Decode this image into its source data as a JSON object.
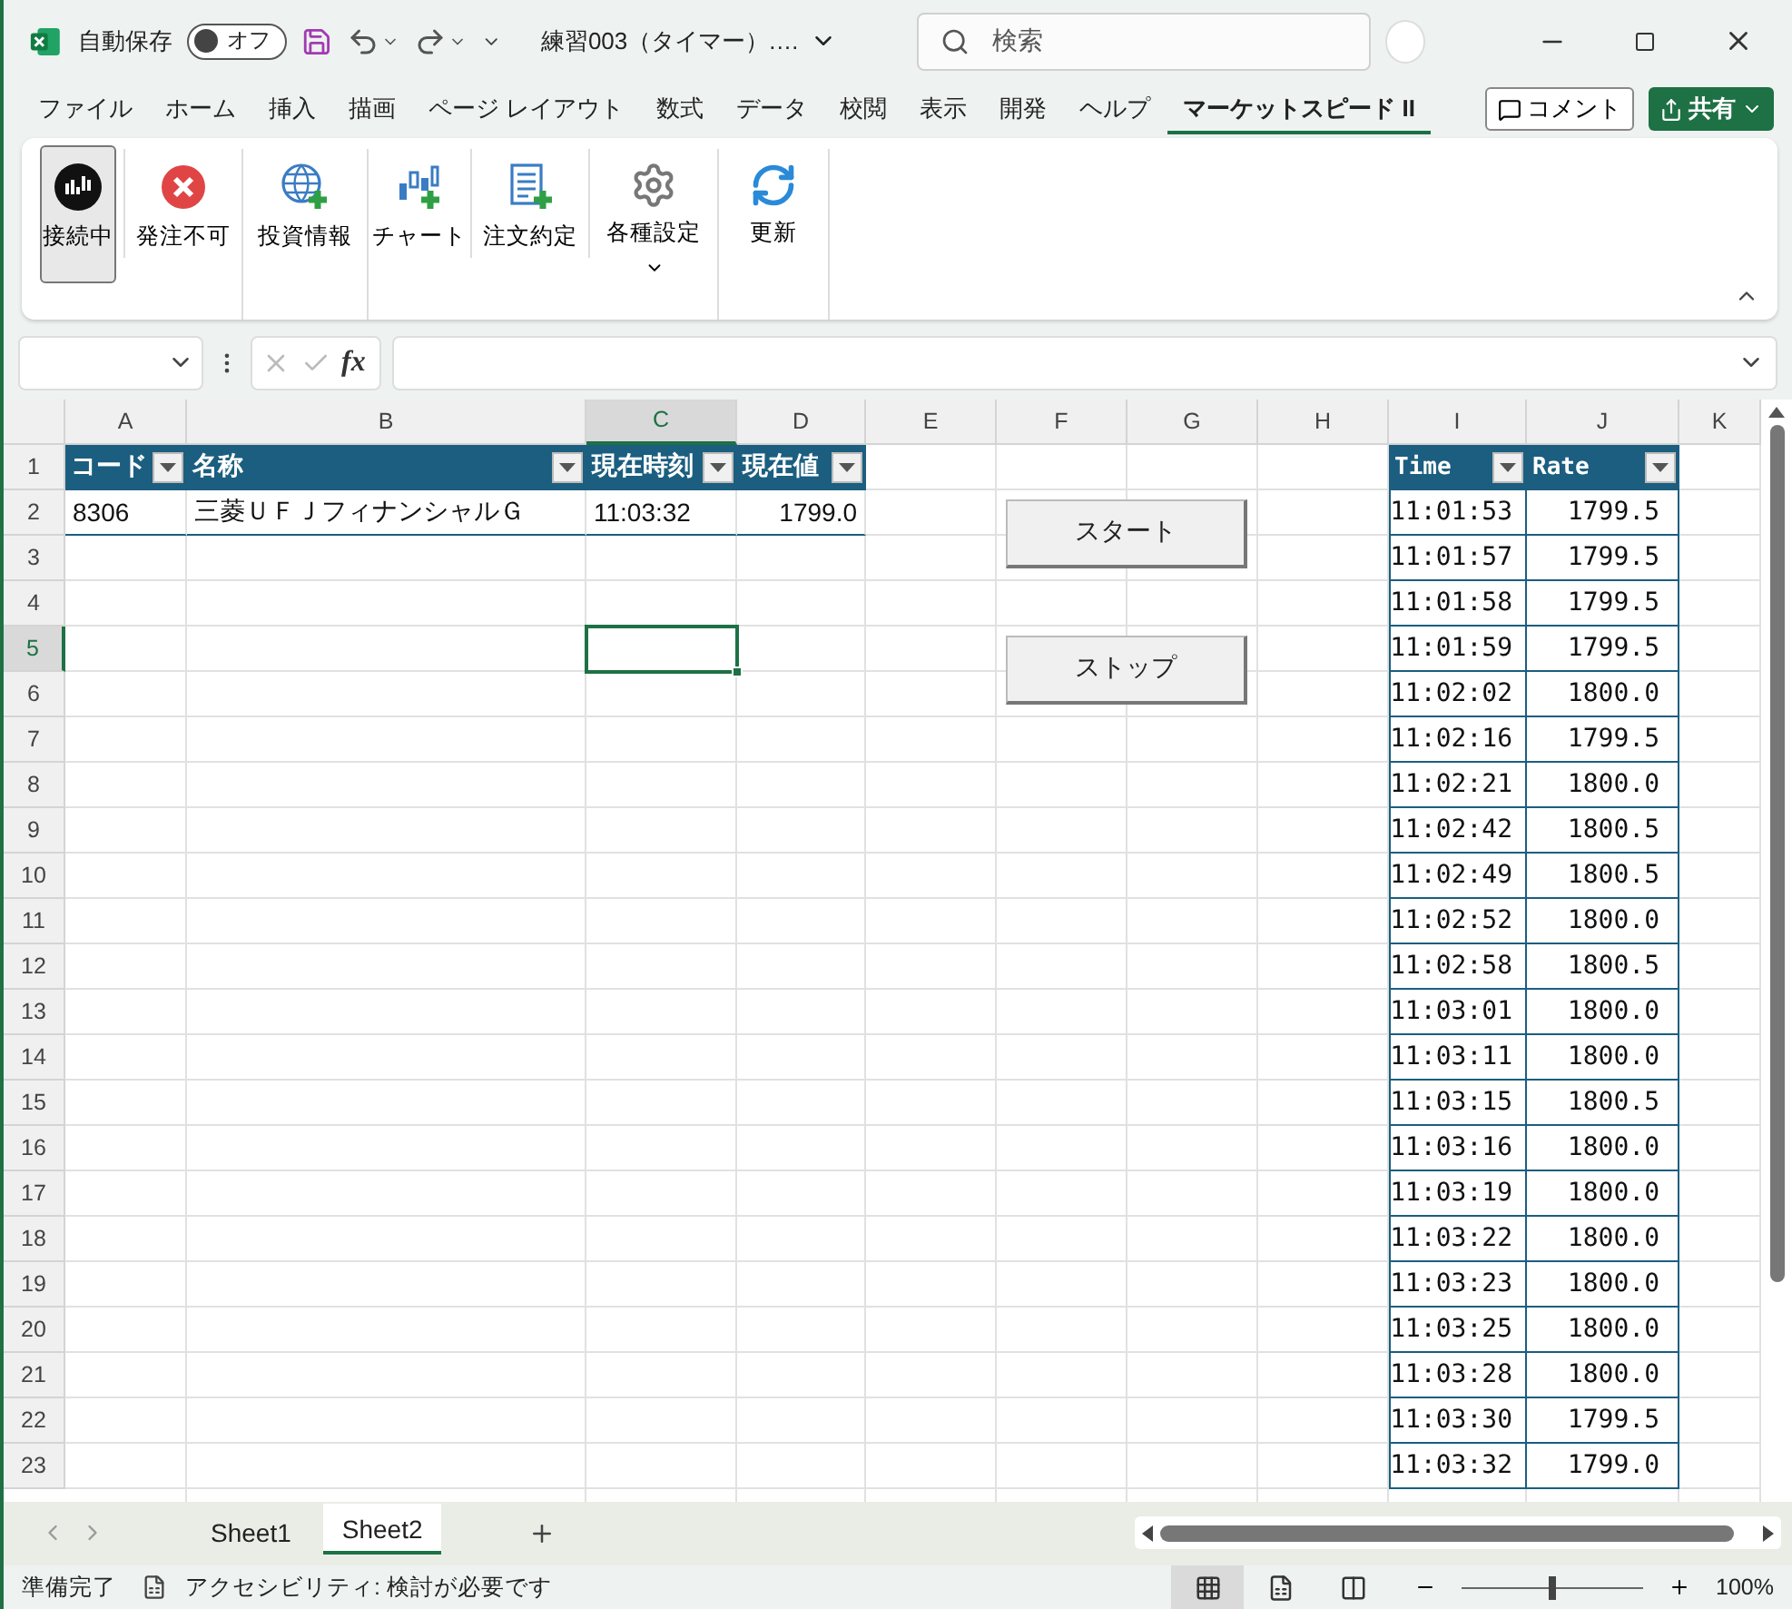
{
  "title_bar": {
    "autosave_label": "自動保存",
    "autosave": {
      "on": false,
      "label": "オフ"
    },
    "document_title": "練習003（タイマー）.…",
    "search": {
      "placeholder": "検索"
    }
  },
  "menu_tabs": [
    {
      "label": "ファイル",
      "selected": false
    },
    {
      "label": "ホーム",
      "selected": false
    },
    {
      "label": "挿入",
      "selected": false
    },
    {
      "label": "描画",
      "selected": false
    },
    {
      "label": "ページ レイアウト",
      "selected": false
    },
    {
      "label": "数式",
      "selected": false
    },
    {
      "label": "データ",
      "selected": false
    },
    {
      "label": "校閲",
      "selected": false
    },
    {
      "label": "表示",
      "selected": false
    },
    {
      "label": "開発",
      "selected": false
    },
    {
      "label": "ヘルプ",
      "selected": false
    },
    {
      "label": "マーケットスピード II",
      "selected": true
    }
  ],
  "comment_button": "コメント",
  "share_button": "共有",
  "ribbon": {
    "buttons": [
      {
        "label": "接続中",
        "selected": true,
        "has_menu": false
      },
      {
        "label": "発注不可",
        "selected": false,
        "has_menu": false
      },
      {
        "label": "投資情報",
        "selected": false,
        "has_menu": false
      },
      {
        "label": "チャート",
        "selected": false,
        "has_menu": false
      },
      {
        "label": "注文約定",
        "selected": false,
        "has_menu": false
      },
      {
        "label": "各種設定",
        "selected": false,
        "has_menu": true
      },
      {
        "label": "更新",
        "selected": false,
        "has_menu": false
      }
    ]
  },
  "formula_bar": {
    "fx_label": "fx"
  },
  "sheet": {
    "columns": [
      {
        "label": "A",
        "selected": false
      },
      {
        "label": "B",
        "selected": false
      },
      {
        "label": "C",
        "selected": true
      },
      {
        "label": "D",
        "selected": false
      },
      {
        "label": "E",
        "selected": false
      },
      {
        "label": "F",
        "selected": false
      },
      {
        "label": "G",
        "selected": false
      },
      {
        "label": "H",
        "selected": false
      },
      {
        "label": "I",
        "selected": false
      },
      {
        "label": "J",
        "selected": false
      },
      {
        "label": "K",
        "selected": false
      }
    ],
    "rows": [
      {
        "label": "1",
        "selected": false
      },
      {
        "label": "2",
        "selected": false
      },
      {
        "label": "3",
        "selected": false
      },
      {
        "label": "4",
        "selected": false
      },
      {
        "label": "5",
        "selected": true
      },
      {
        "label": "6",
        "selected": false
      },
      {
        "label": "7",
        "selected": false
      },
      {
        "label": "8",
        "selected": false
      },
      {
        "label": "9",
        "selected": false
      },
      {
        "label": "10",
        "selected": false
      },
      {
        "label": "11",
        "selected": false
      },
      {
        "label": "12",
        "selected": false
      },
      {
        "label": "13",
        "selected": false
      },
      {
        "label": "14",
        "selected": false
      },
      {
        "label": "15",
        "selected": false
      },
      {
        "label": "16",
        "selected": false
      },
      {
        "label": "17",
        "selected": false
      },
      {
        "label": "18",
        "selected": false
      },
      {
        "label": "19",
        "selected": false
      },
      {
        "label": "20",
        "selected": false
      },
      {
        "label": "21",
        "selected": false
      },
      {
        "label": "22",
        "selected": false
      },
      {
        "label": "23",
        "selected": false
      }
    ],
    "quote_table": {
      "columns": [
        {
          "label": "コード",
          "kind": "text"
        },
        {
          "label": "名称",
          "kind": "text"
        },
        {
          "label": "現在時刻",
          "kind": "text"
        },
        {
          "label": "現在値",
          "kind": "number"
        }
      ],
      "rows": [
        [
          "8306",
          "三菱ＵＦＪフィナンシャルＧ",
          "11:03:32",
          "1799.0"
        ]
      ]
    },
    "history_table": {
      "columns": [
        {
          "label": "Time",
          "kind": "number"
        },
        {
          "label": "Rate",
          "kind": "number"
        }
      ],
      "rows": [
        [
          "11:01:53",
          "1799.5"
        ],
        [
          "11:01:57",
          "1799.5"
        ],
        [
          "11:01:58",
          "1799.5"
        ],
        [
          "11:01:59",
          "1799.5"
        ],
        [
          "11:02:02",
          "1800.0"
        ],
        [
          "11:02:16",
          "1799.5"
        ],
        [
          "11:02:21",
          "1800.0"
        ],
        [
          "11:02:42",
          "1800.5"
        ],
        [
          "11:02:49",
          "1800.5"
        ],
        [
          "11:02:52",
          "1800.0"
        ],
        [
          "11:02:58",
          "1800.5"
        ],
        [
          "11:03:01",
          "1800.0"
        ],
        [
          "11:03:11",
          "1800.0"
        ],
        [
          "11:03:15",
          "1800.5"
        ],
        [
          "11:03:16",
          "1800.0"
        ],
        [
          "11:03:19",
          "1800.0"
        ],
        [
          "11:03:22",
          "1800.0"
        ],
        [
          "11:03:23",
          "1800.0"
        ],
        [
          "11:03:25",
          "1800.0"
        ],
        [
          "11:03:28",
          "1800.0"
        ],
        [
          "11:03:30",
          "1799.5"
        ],
        [
          "11:03:32",
          "1799.0"
        ]
      ]
    },
    "buttons": [
      "スタート",
      "ストップ"
    ]
  },
  "sheet_tabs": [
    {
      "label": "Sheet1",
      "selected": false
    },
    {
      "label": "Sheet2",
      "selected": true
    }
  ],
  "status_bar": {
    "status": "準備完了",
    "accessibility": "アクセシビリティ: 検討が必要です",
    "views": [
      {
        "kind": "normal",
        "selected": true
      },
      {
        "kind": "page_layout",
        "selected": false
      },
      {
        "kind": "page_break",
        "selected": false
      }
    ],
    "zoom": {
      "level": 0.5,
      "reading": "100%"
    }
  }
}
